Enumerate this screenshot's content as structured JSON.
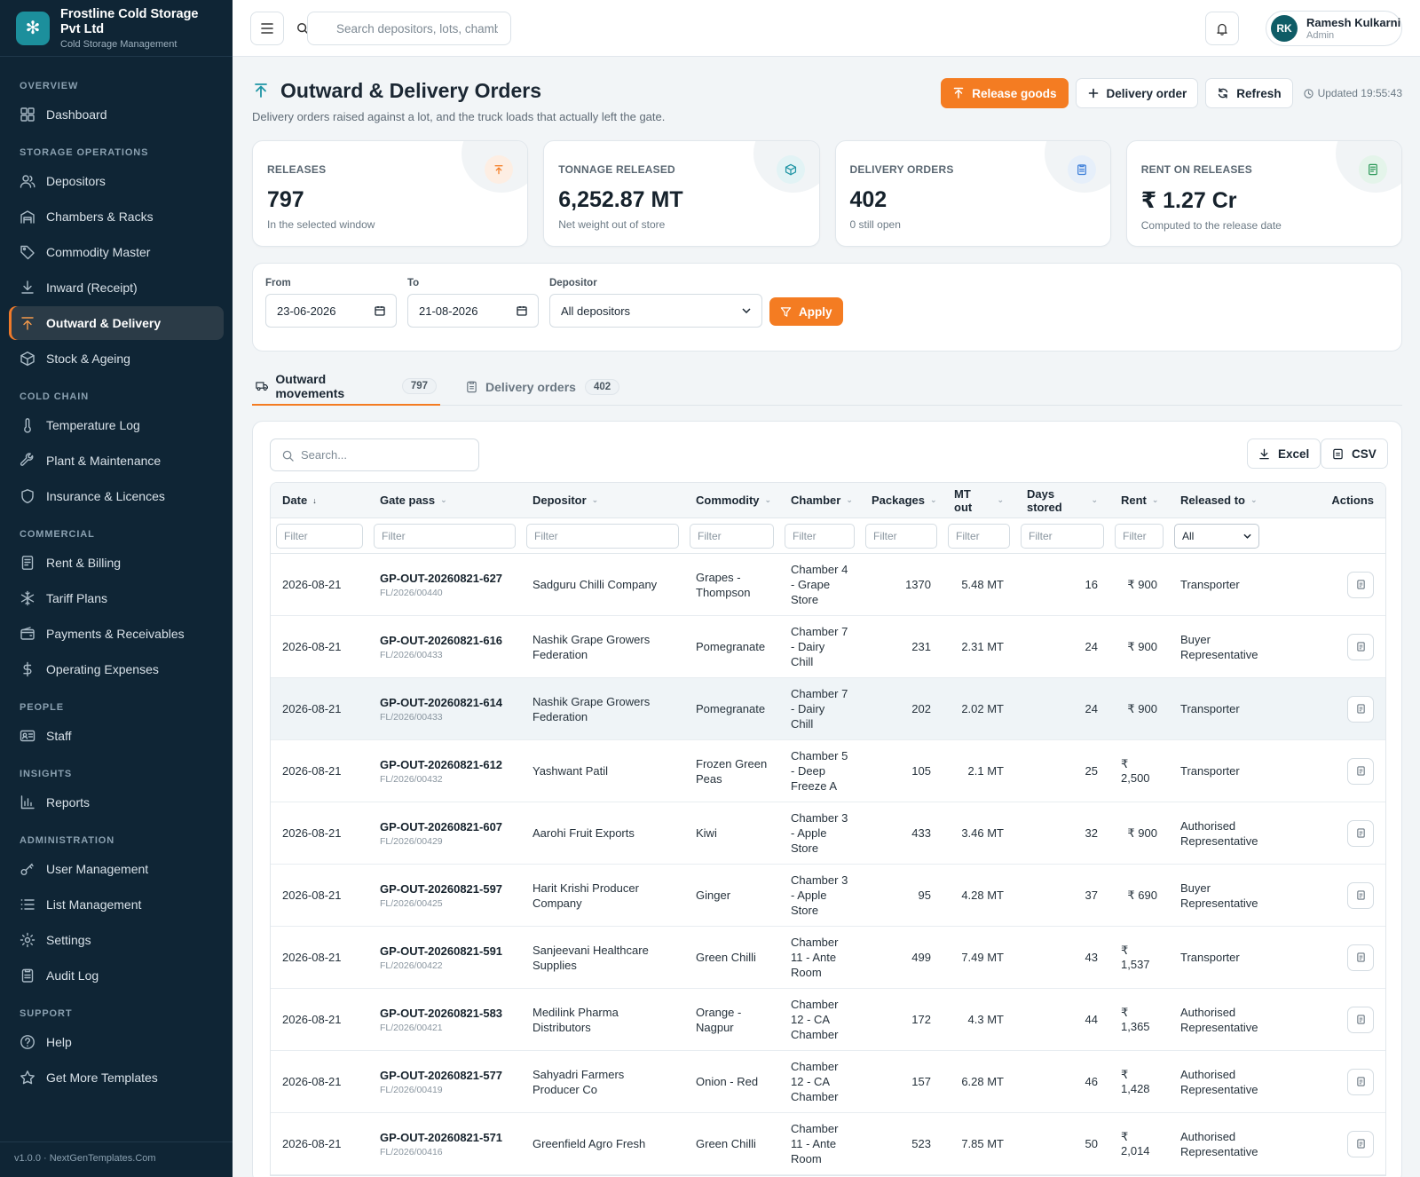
{
  "brand": {
    "name": "Frostline Cold Storage Pvt Ltd",
    "subtitle": "Cold Storage Management",
    "logo_icon": "snowflake-icon"
  },
  "sidebar": {
    "sections": [
      {
        "title": "OVERVIEW",
        "items": [
          {
            "label": "Dashboard",
            "icon": "dashboard-icon"
          }
        ]
      },
      {
        "title": "STORAGE OPERATIONS",
        "items": [
          {
            "label": "Depositors",
            "icon": "users-icon"
          },
          {
            "label": "Chambers & Racks",
            "icon": "warehouse-icon"
          },
          {
            "label": "Commodity Master",
            "icon": "tag-icon"
          },
          {
            "label": "Inward (Receipt)",
            "icon": "download-icon"
          },
          {
            "label": "Outward & Delivery",
            "icon": "upload-icon",
            "active": true
          },
          {
            "label": "Stock & Ageing",
            "icon": "box-icon"
          }
        ]
      },
      {
        "title": "COLD CHAIN",
        "items": [
          {
            "label": "Temperature Log",
            "icon": "thermometer-icon"
          },
          {
            "label": "Plant & Maintenance",
            "icon": "wrench-icon"
          },
          {
            "label": "Insurance & Licences",
            "icon": "shield-icon"
          }
        ]
      },
      {
        "title": "COMMERCIAL",
        "items": [
          {
            "label": "Rent & Billing",
            "icon": "invoice-icon"
          },
          {
            "label": "Tariff Plans",
            "icon": "snowflake-icon"
          },
          {
            "label": "Payments & Receivables",
            "icon": "wallet-icon"
          },
          {
            "label": "Operating Expenses",
            "icon": "dollar-icon"
          }
        ]
      },
      {
        "title": "PEOPLE",
        "items": [
          {
            "label": "Staff",
            "icon": "id-card-icon"
          }
        ]
      },
      {
        "title": "INSIGHTS",
        "items": [
          {
            "label": "Reports",
            "icon": "bar-chart-icon"
          }
        ]
      },
      {
        "title": "ADMINISTRATION",
        "items": [
          {
            "label": "User Management",
            "icon": "key-icon"
          },
          {
            "label": "List Management",
            "icon": "list-icon"
          },
          {
            "label": "Settings",
            "icon": "gear-icon"
          },
          {
            "label": "Audit Log",
            "icon": "clipboard-icon"
          }
        ]
      },
      {
        "title": "SUPPORT",
        "items": [
          {
            "label": "Help",
            "icon": "help-icon"
          },
          {
            "label": "Get More Templates",
            "icon": "star-icon"
          }
        ]
      }
    ],
    "footer": "v1.0.0 · NextGenTemplates.Com"
  },
  "topbar": {
    "search_placeholder": "Search depositors, lots, chambers...",
    "user": {
      "initials": "RK",
      "name": "Ramesh Kulkarni",
      "role": "Admin"
    }
  },
  "page": {
    "title": "Outward & Delivery Orders",
    "subtitle": "Delivery orders raised against a lot, and the truck loads that actually left the gate.",
    "actions": {
      "release": "Release goods",
      "delivery": "Delivery order",
      "refresh": "Refresh"
    },
    "updated": "Updated 19:55:43"
  },
  "kpis": [
    {
      "label": "RELEASES",
      "value": "797",
      "note": "In the selected window",
      "icon": "upload-icon",
      "color": "#f47c22",
      "bg": "#fdeee3"
    },
    {
      "label": "TONNAGE RELEASED",
      "value": "6,252.87 MT",
      "note": "Net weight out of store",
      "icon": "box-icon",
      "color": "#1f95a5",
      "bg": "#e2f3f5"
    },
    {
      "label": "DELIVERY ORDERS",
      "value": "402",
      "note": "0 still open",
      "icon": "clipboard-icon",
      "color": "#3d7fd9",
      "bg": "#e6effa"
    },
    {
      "label": "RENT ON RELEASES",
      "value": "₹ 1.27 Cr",
      "note": "Computed to the release date",
      "icon": "invoice-icon",
      "color": "#2f9a5b",
      "bg": "#e4f4ea"
    }
  ],
  "filters": {
    "from_label": "From",
    "from_value": "23-06-2026",
    "to_label": "To",
    "to_value": "21-08-2026",
    "depositor_label": "Depositor",
    "depositor_value": "All depositors",
    "apply": "Apply"
  },
  "tabs": [
    {
      "label": "Outward movements",
      "count": "797",
      "active": true
    },
    {
      "label": "Delivery orders",
      "count": "402"
    }
  ],
  "table": {
    "search_placeholder": "Search...",
    "export_excel": "Excel",
    "export_csv": "CSV",
    "columns": [
      "Date",
      "Gate pass",
      "Depositor",
      "Commodity",
      "Chamber",
      "Packages",
      "MT out",
      "Days stored",
      "Rent",
      "Released to",
      "Actions"
    ],
    "filter_placeholder": "Filter",
    "released_filter_value": "All",
    "rows": [
      {
        "date": "2026-08-21",
        "gate_pass": "GP-OUT-20260821-627",
        "lot": "FL/2026/00440",
        "depositor": "Sadguru Chilli Company",
        "commodity": "Grapes - Thompson",
        "chamber": "Chamber 4 - Grape Store",
        "packages": "1370",
        "mt_out": "5.48 MT",
        "days": "16",
        "rent": "₹ 900",
        "released_to": "Transporter"
      },
      {
        "date": "2026-08-21",
        "gate_pass": "GP-OUT-20260821-616",
        "lot": "FL/2026/00433",
        "depositor": "Nashik Grape Growers Federation",
        "commodity": "Pomegranate",
        "chamber": "Chamber 7 - Dairy Chill",
        "packages": "231",
        "mt_out": "2.31 MT",
        "days": "24",
        "rent": "₹ 900",
        "released_to": "Buyer Representative"
      },
      {
        "date": "2026-08-21",
        "gate_pass": "GP-OUT-20260821-614",
        "lot": "FL/2026/00433",
        "depositor": "Nashik Grape Growers Federation",
        "commodity": "Pomegranate",
        "chamber": "Chamber 7 - Dairy Chill",
        "packages": "202",
        "mt_out": "2.02 MT",
        "days": "24",
        "rent": "₹ 900",
        "released_to": "Transporter"
      },
      {
        "date": "2026-08-21",
        "gate_pass": "GP-OUT-20260821-612",
        "lot": "FL/2026/00432",
        "depositor": "Yashwant Patil",
        "commodity": "Frozen Green Peas",
        "chamber": "Chamber 5 - Deep Freeze A",
        "packages": "105",
        "mt_out": "2.1 MT",
        "days": "25",
        "rent": "₹ 2,500",
        "released_to": "Transporter"
      },
      {
        "date": "2026-08-21",
        "gate_pass": "GP-OUT-20260821-607",
        "lot": "FL/2026/00429",
        "depositor": "Aarohi Fruit Exports",
        "commodity": "Kiwi",
        "chamber": "Chamber 3 - Apple Store",
        "packages": "433",
        "mt_out": "3.46 MT",
        "days": "32",
        "rent": "₹ 900",
        "released_to": "Authorised Representative"
      },
      {
        "date": "2026-08-21",
        "gate_pass": "GP-OUT-20260821-597",
        "lot": "FL/2026/00425",
        "depositor": "Harit Krishi Producer Company",
        "commodity": "Ginger",
        "chamber": "Chamber 3 - Apple Store",
        "packages": "95",
        "mt_out": "4.28 MT",
        "days": "37",
        "rent": "₹ 690",
        "released_to": "Buyer Representative"
      },
      {
        "date": "2026-08-21",
        "gate_pass": "GP-OUT-20260821-591",
        "lot": "FL/2026/00422",
        "depositor": "Sanjeevani Healthcare Supplies",
        "commodity": "Green Chilli",
        "chamber": "Chamber 11 - Ante Room",
        "packages": "499",
        "mt_out": "7.49 MT",
        "days": "43",
        "rent": "₹ 1,537",
        "released_to": "Transporter"
      },
      {
        "date": "2026-08-21",
        "gate_pass": "GP-OUT-20260821-583",
        "lot": "FL/2026/00421",
        "depositor": "Medilink Pharma Distributors",
        "commodity": "Orange - Nagpur",
        "chamber": "Chamber 12 - CA Chamber",
        "packages": "172",
        "mt_out": "4.3 MT",
        "days": "44",
        "rent": "₹ 1,365",
        "released_to": "Authorised Representative"
      },
      {
        "date": "2026-08-21",
        "gate_pass": "GP-OUT-20260821-577",
        "lot": "FL/2026/00419",
        "depositor": "Sahyadri Farmers Producer Co",
        "commodity": "Onion - Red",
        "chamber": "Chamber 12 - CA Chamber",
        "packages": "157",
        "mt_out": "6.28 MT",
        "days": "46",
        "rent": "₹ 1,428",
        "released_to": "Authorised Representative"
      },
      {
        "date": "2026-08-21",
        "gate_pass": "GP-OUT-20260821-571",
        "lot": "FL/2026/00416",
        "depositor": "Greenfield Agro Fresh",
        "commodity": "Green Chilli",
        "chamber": "Chamber 11 - Ante Room",
        "packages": "523",
        "mt_out": "7.85 MT",
        "days": "50",
        "rent": "₹ 2,014",
        "released_to": "Authorised Representative"
      }
    ]
  }
}
